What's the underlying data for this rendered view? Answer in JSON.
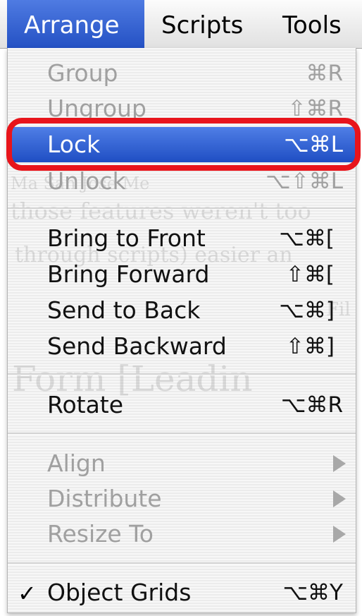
{
  "menubar": {
    "items": [
      {
        "label": "Arrange",
        "active": true
      },
      {
        "label": "Scripts",
        "active": false
      },
      {
        "label": "Tools",
        "active": false
      }
    ]
  },
  "menu": {
    "background_text": [
      "Ma        San Jose Me",
      "those features weren't too",
      "through scripts) easier an",
      "Fil",
      "Form [Leadin"
    ],
    "groups": [
      [
        {
          "label": "Group",
          "shortcut": "⌘R",
          "state": "disabled"
        },
        {
          "label": "Ungroup",
          "shortcut": "⇧⌘R",
          "state": "disabled"
        },
        {
          "label": "Lock",
          "shortcut": "⌥⌘L",
          "state": "selected"
        },
        {
          "label": "Unlock",
          "shortcut": "⌥⇧⌘L",
          "state": "disabled"
        }
      ],
      [
        {
          "label": "Bring to Front",
          "shortcut": "⌥⌘[",
          "state": "enabled"
        },
        {
          "label": "Bring Forward",
          "shortcut": "⇧⌘[",
          "state": "enabled"
        },
        {
          "label": "Send to Back",
          "shortcut": "⌥⌘]",
          "state": "enabled"
        },
        {
          "label": "Send Backward",
          "shortcut": "⇧⌘]",
          "state": "enabled"
        }
      ],
      [
        {
          "label": "Rotate",
          "shortcut": "⌥⌘R",
          "state": "enabled"
        }
      ],
      [
        {
          "label": "Align",
          "submenu": true,
          "state": "disabled"
        },
        {
          "label": "Distribute",
          "submenu": true,
          "state": "disabled"
        },
        {
          "label": "Resize To",
          "submenu": true,
          "state": "disabled"
        }
      ],
      [
        {
          "label": "Object Grids",
          "shortcut": "⌥⌘Y",
          "state": "enabled",
          "checked": true,
          "check_glyph": "✓"
        }
      ]
    ]
  },
  "annotation": {
    "color": "#e8141b"
  },
  "colors": {
    "selection": "#2a5ccc",
    "disabled_text": "#a0a0a0"
  }
}
